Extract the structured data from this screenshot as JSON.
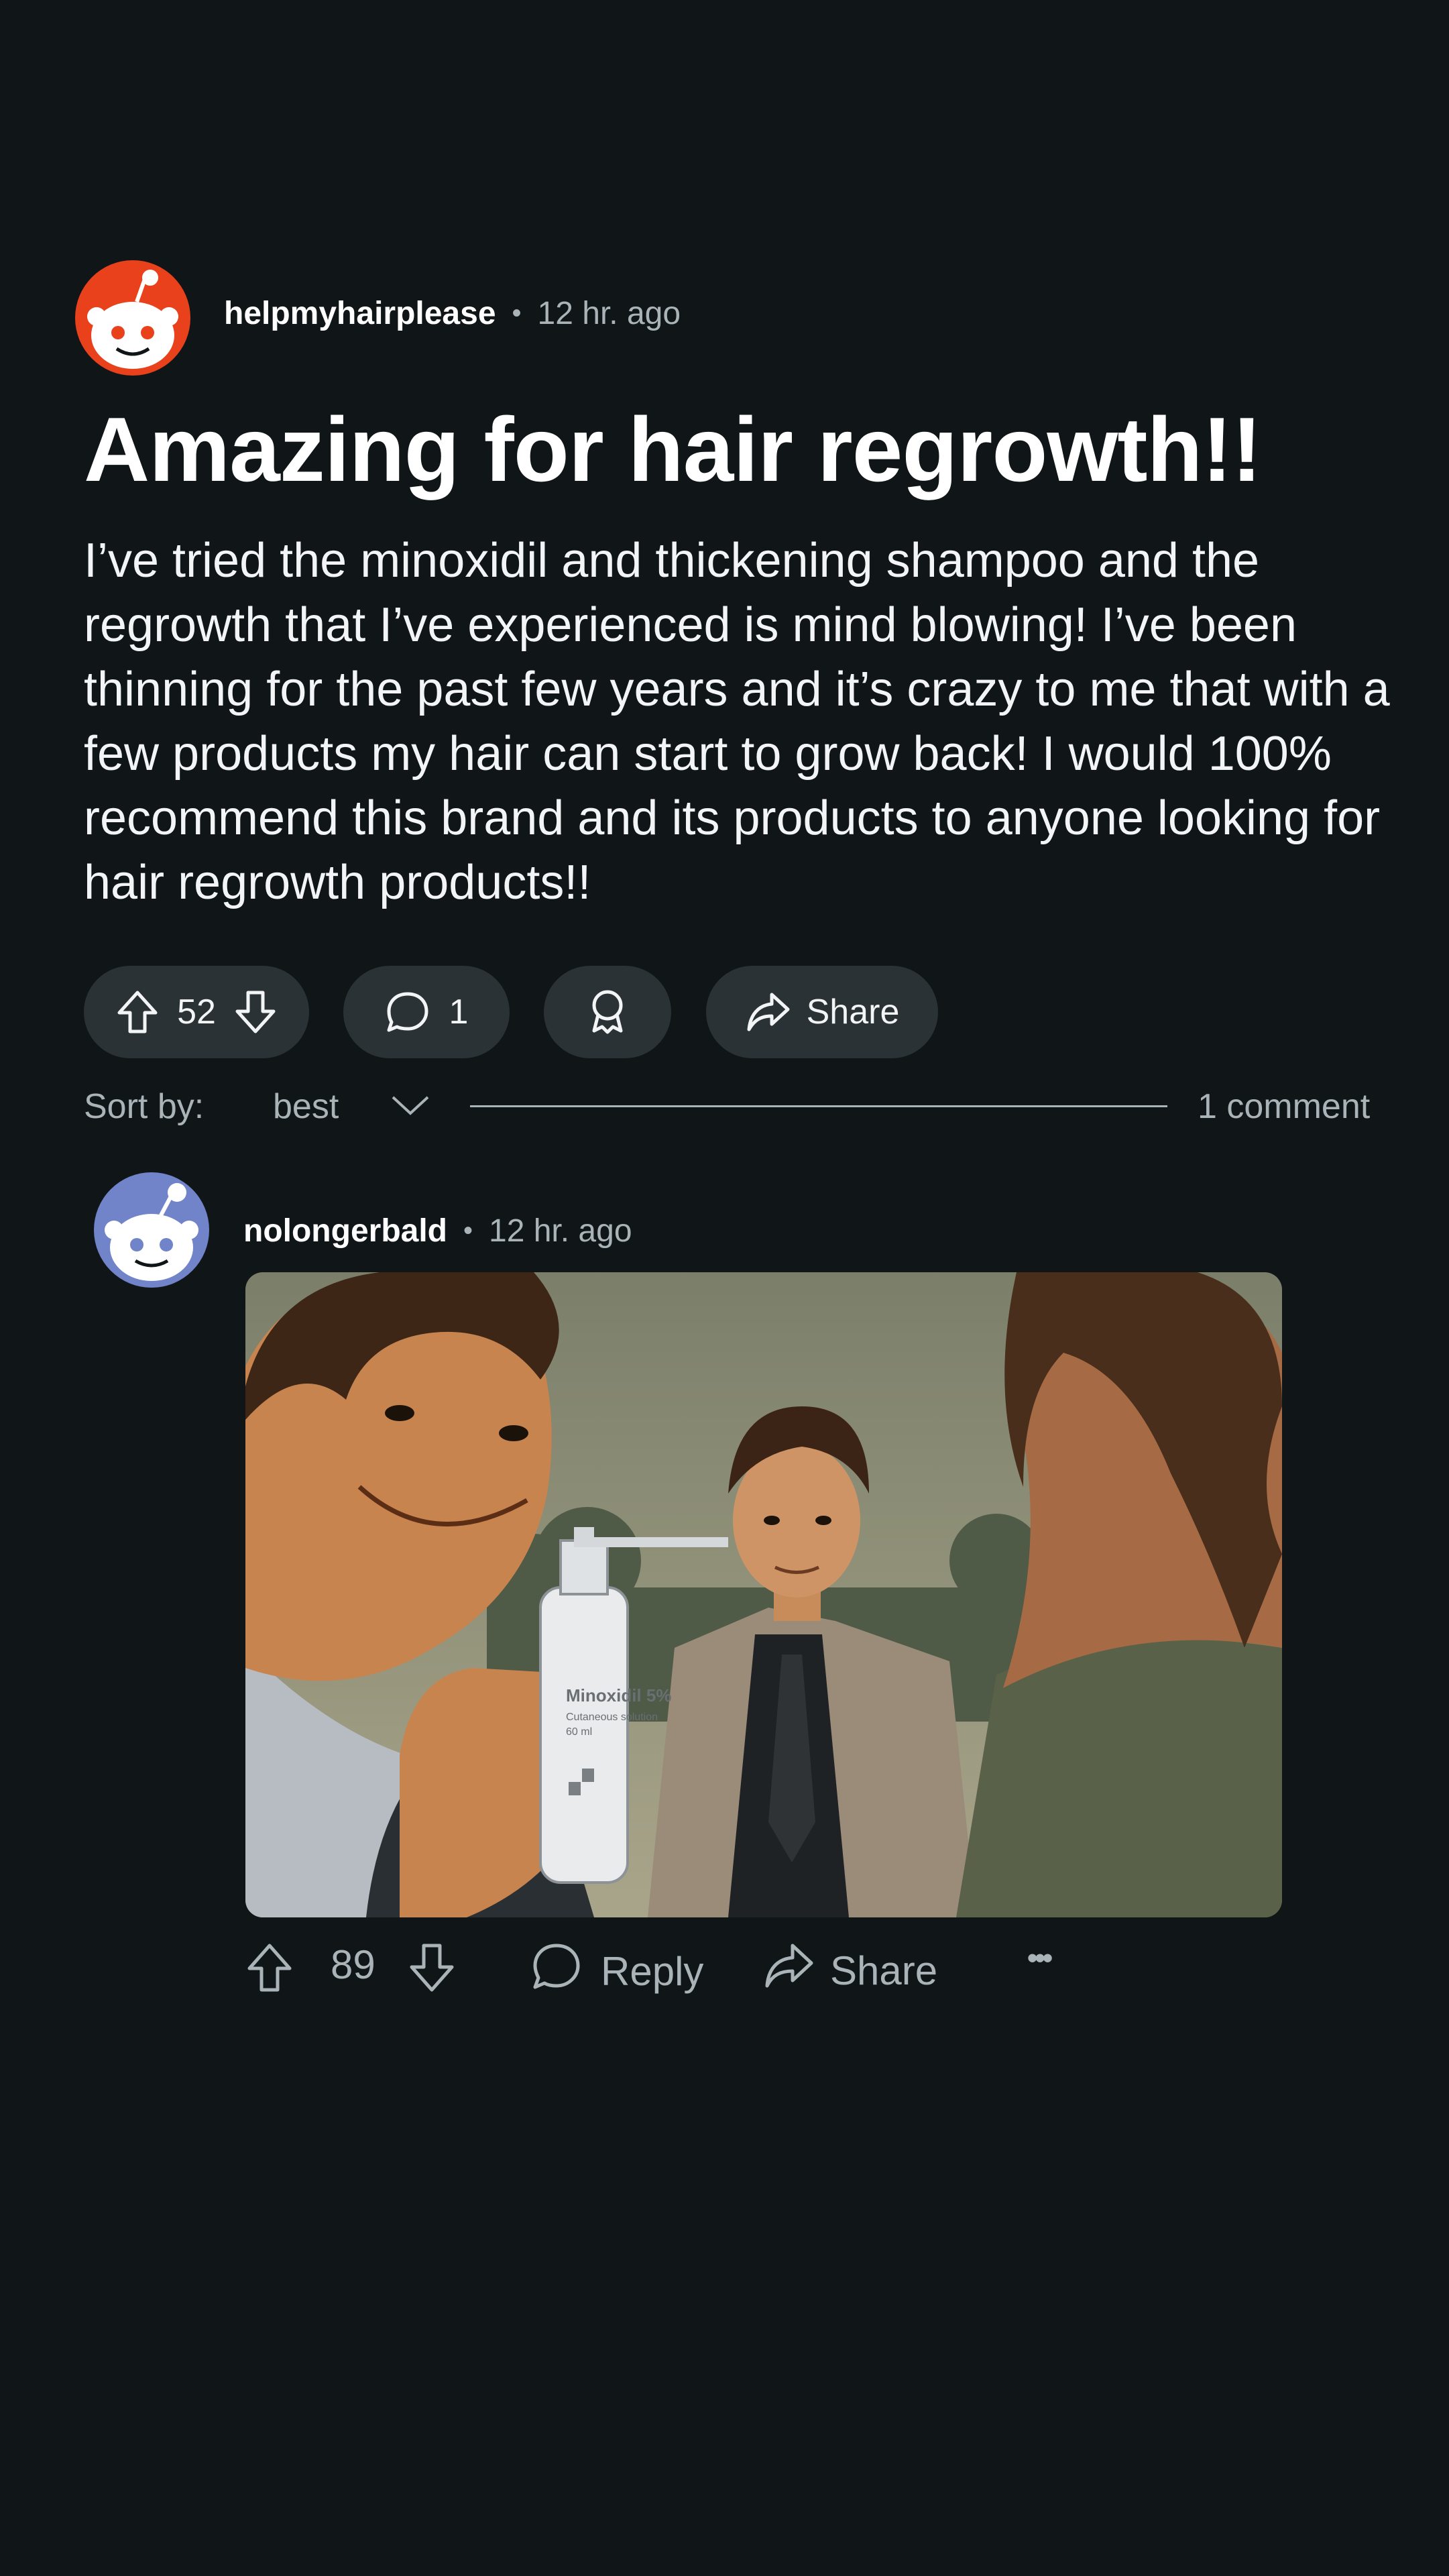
{
  "post": {
    "author": "helpmyhairplease",
    "separator": "•",
    "time": "12 hr. ago",
    "title": "Amazing for hair regrowth!!",
    "body": "I’ve tried the minoxidil and thickening shampoo and the regrowth that I’ve experienced is mind blowing! I’ve been thinning for the past few years and it’s crazy to me that with a few products my hair can start to grow back! I would 100% recommend this brand and its products to anyone looking for hair regrowth products!!",
    "votes": "52",
    "comments": "1",
    "share_label": "Share"
  },
  "sort": {
    "label": "Sort by:",
    "value": "best",
    "comment_count": "1 comment"
  },
  "comment": {
    "author": "nolongerbald",
    "separator": "•",
    "time": "12 hr. ago",
    "image": {
      "bottle_label": "Minoxidil 5%",
      "bottle_sub": "Cutaneous solution",
      "bottle_volume": "60 ml"
    },
    "votes": "89",
    "reply_label": "Reply",
    "share_label": "Share",
    "more_label": "•••"
  },
  "colors": {
    "background": "#101618",
    "pill": "#2a3236",
    "muted_text": "#aab4b8",
    "op_avatar": "#e8411b",
    "commenter_avatar": "#7183c9"
  },
  "icons": {
    "upvote": "upvote-icon",
    "downvote": "downvote-icon",
    "comment": "comment-bubble-icon",
    "award": "award-icon",
    "share": "share-arrow-icon",
    "chevron": "chevron-down-icon",
    "more": "more-dots-icon"
  }
}
